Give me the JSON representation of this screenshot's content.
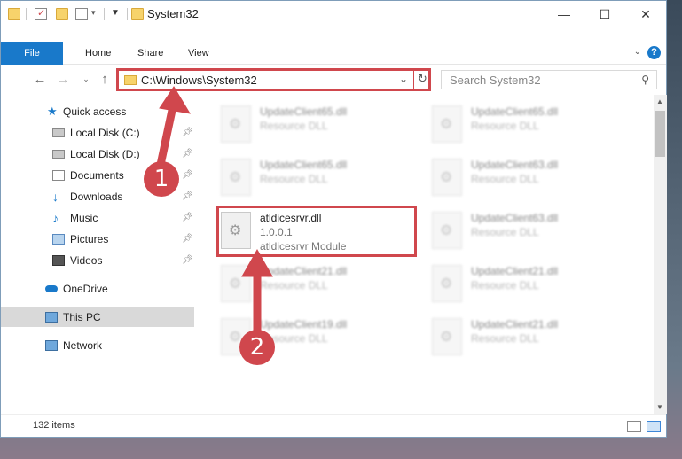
{
  "window": {
    "title": "System32"
  },
  "ribbon": {
    "tabs": [
      "File",
      "Home",
      "Share",
      "View"
    ],
    "help_glyph": "?"
  },
  "address": {
    "path": "C:\\Windows\\System32"
  },
  "search": {
    "placeholder": "Search System32"
  },
  "sidebar": {
    "items": [
      {
        "label": "Quick access",
        "icon": "star-icon",
        "pinned": false
      },
      {
        "label": "Local Disk (C:)",
        "icon": "drive-icon",
        "pinned": true
      },
      {
        "label": "Local Disk (D:)",
        "icon": "drive-icon",
        "pinned": true
      },
      {
        "label": "Documents",
        "icon": "documents-icon",
        "pinned": true
      },
      {
        "label": "Downloads",
        "icon": "download-icon",
        "pinned": true
      },
      {
        "label": "Music",
        "icon": "music-icon",
        "pinned": true
      },
      {
        "label": "Pictures",
        "icon": "pictures-icon",
        "pinned": true
      },
      {
        "label": "Videos",
        "icon": "video-icon",
        "pinned": true
      },
      {
        "label": "OneDrive",
        "icon": "cloud-icon",
        "pinned": false
      },
      {
        "label": "This PC",
        "icon": "computer-icon",
        "pinned": false
      },
      {
        "label": "Network",
        "icon": "network-icon",
        "pinned": false
      }
    ]
  },
  "files": [
    {
      "name": "UpdateClient65.dll",
      "line2": "Resource DLL"
    },
    {
      "name": "UpdateClient65.dll",
      "line2": "Resource DLL"
    },
    {
      "name": "UpdateClient65.dll",
      "line2": "Resource DLL"
    },
    {
      "name": "UpdateClient63.dll",
      "line2": "Resource DLL"
    },
    {
      "name": "atldicesrvr.dll",
      "line2": "1.0.0.1",
      "line3": "atldicesrvr Module"
    },
    {
      "name": "UpdateClient63.dll",
      "line2": "Resource DLL"
    },
    {
      "name": "UpdateClient21.dll",
      "line2": "Resource DLL"
    },
    {
      "name": "UpdateClient21.dll",
      "line2": "Resource DLL"
    },
    {
      "name": "UpdateClient19.dll",
      "line2": "Resource DLL"
    },
    {
      "name": "UpdateClient21.dll",
      "line2": "Resource DLL"
    }
  ],
  "status": {
    "items_count": "132 items"
  },
  "annotations": {
    "step1": "1",
    "step2": "2"
  },
  "colors": {
    "accent": "#1979ca",
    "highlight": "#d0474d"
  }
}
